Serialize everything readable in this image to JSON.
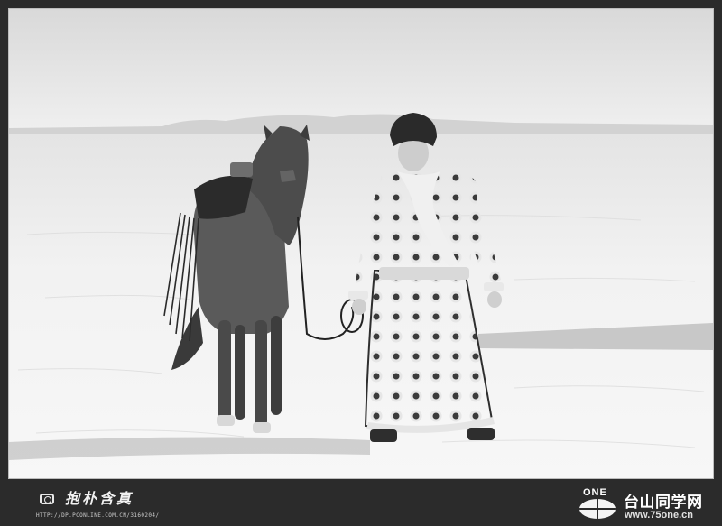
{
  "footer": {
    "left_brand": "抱朴含真",
    "left_url": "HTTP://DP.PCONLINE.COM.CN/3160204/",
    "right_logo_text": "ONE",
    "right_site_name": "台山同学网",
    "right_domain": "www.75one.cn"
  },
  "icons": {
    "camera": "camera-icon",
    "globe": "globe-icon"
  },
  "colors": {
    "frame": "#2b2b2b",
    "snow": "#f3f3f3",
    "robe": "#2e2e2e"
  }
}
